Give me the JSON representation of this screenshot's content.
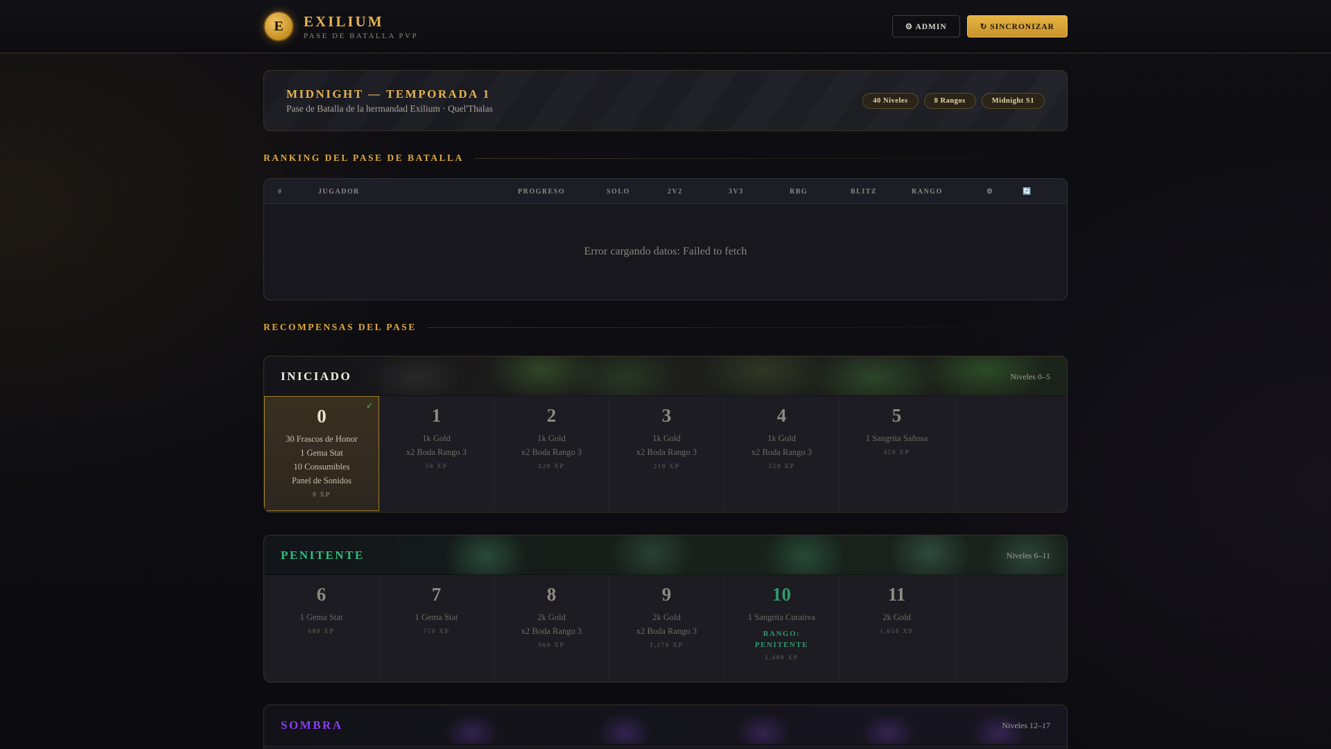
{
  "header": {
    "logo_letter": "E",
    "brand_name": "EXILIUM",
    "brand_sub": "PASE DE BATALLA PVP",
    "admin_label": "⚙ ADMIN",
    "sync_label": "↻ SINCRONIZAR"
  },
  "season": {
    "title": "MIDNIGHT — TEMPORADA 1",
    "subtitle": "Pase de Batalla de la hermandad Exilium · Quel'Thalas",
    "tags": [
      "40 Niveles",
      "8 Rangos",
      "Midnight S1"
    ]
  },
  "ranking": {
    "heading": "RANKING DEL PASE DE BATALLA",
    "columns": [
      "#",
      "JUGADOR",
      "PROGRESO",
      "SOLO",
      "2V2",
      "3V3",
      "RBG",
      "BLITZ",
      "RANGO",
      "⚙",
      "🔄"
    ],
    "message": "Error cargando datos: Failed to fetch"
  },
  "rewards": {
    "heading": "RECOMPENSAS DEL PASE",
    "tiers": [
      {
        "name": "INICIADO",
        "range": "Niveles 0–5",
        "color": "#f2efe6",
        "levels": [
          {
            "num": "0",
            "rewards": [
              "30 Frascos de Honor",
              "1 Gema Stat",
              "10 Consumibles",
              "Panel de Sonidos"
            ],
            "xp": "0 XP",
            "unlocked": true
          },
          {
            "num": "1",
            "rewards": [
              "1k Gold",
              "x2 Boda Rango 3"
            ],
            "xp": "50 XP"
          },
          {
            "num": "2",
            "rewards": [
              "1k Gold",
              "x2 Boda Rango 3"
            ],
            "xp": "120 XP"
          },
          {
            "num": "3",
            "rewards": [
              "1k Gold",
              "x2 Boda Rango 3"
            ],
            "xp": "210 XP"
          },
          {
            "num": "4",
            "rewards": [
              "1k Gold",
              "x2 Boda Rango 3"
            ],
            "xp": "320 XP"
          },
          {
            "num": "5",
            "rewards": [
              "1 Sangrita Sañosa"
            ],
            "xp": "450 XP"
          }
        ]
      },
      {
        "name": "PENITENTE",
        "range": "Niveles 6–11",
        "color": "#2fc07f",
        "levels": [
          {
            "num": "6",
            "rewards": [
              "1 Gema Stat"
            ],
            "xp": "600 XP"
          },
          {
            "num": "7",
            "rewards": [
              "1 Gema Stat"
            ],
            "xp": "770 XP"
          },
          {
            "num": "8",
            "rewards": [
              "2k Gold",
              "x2 Boda Rango 3"
            ],
            "xp": "960 XP"
          },
          {
            "num": "9",
            "rewards": [
              "2k Gold",
              "x2 Boda Rango 3"
            ],
            "xp": "1,170 XP"
          },
          {
            "num": "10",
            "rewards": [
              "1 Sangrita Curativa"
            ],
            "rank": [
              "RANGO:",
              "PENITENTE"
            ],
            "xp": "1,400 XP"
          },
          {
            "num": "11",
            "rewards": [
              "2k Gold"
            ],
            "xp": "1,650 XP"
          }
        ]
      },
      {
        "name": "SOMBRA",
        "range": "Niveles 12–17",
        "color": "#8a3df0",
        "levels": []
      }
    ]
  }
}
